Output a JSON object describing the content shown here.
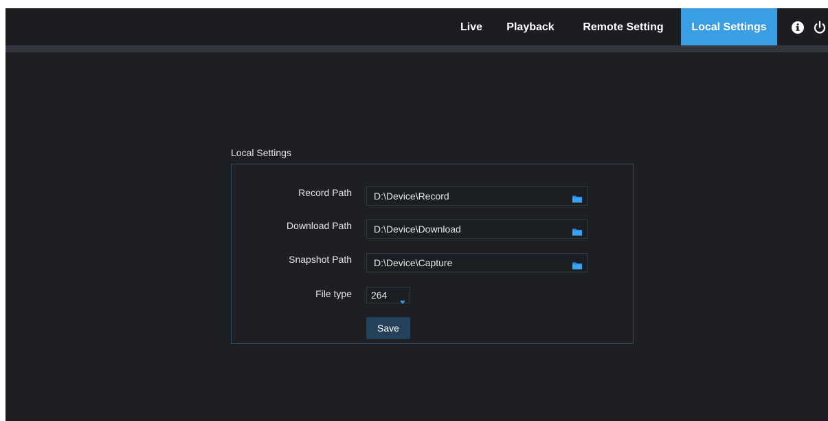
{
  "nav": {
    "live": "Live",
    "playback": "Playback",
    "remote_setting": "Remote Setting",
    "local_settings": "Local Settings",
    "active": "Local Settings"
  },
  "colors": {
    "accent": "#3a9ee4",
    "background": "#1d1f23",
    "panel_border": "#2d4a63",
    "button": "#25405a"
  },
  "icons": {
    "info": "info-icon",
    "power": "power-icon",
    "folder": "folder-icon",
    "dropdown": "caret-down-icon"
  },
  "local_settings": {
    "title": "Local Settings",
    "record_path": {
      "label": "Record Path",
      "value": "D:\\Device\\Record"
    },
    "download_path": {
      "label": "Download Path",
      "value": "D:\\Device\\Download"
    },
    "snapshot_path": {
      "label": "Snapshot Path",
      "value": "D:\\Device\\Capture"
    },
    "file_type": {
      "label": "File type",
      "value": "264"
    },
    "save_label": "Save"
  }
}
